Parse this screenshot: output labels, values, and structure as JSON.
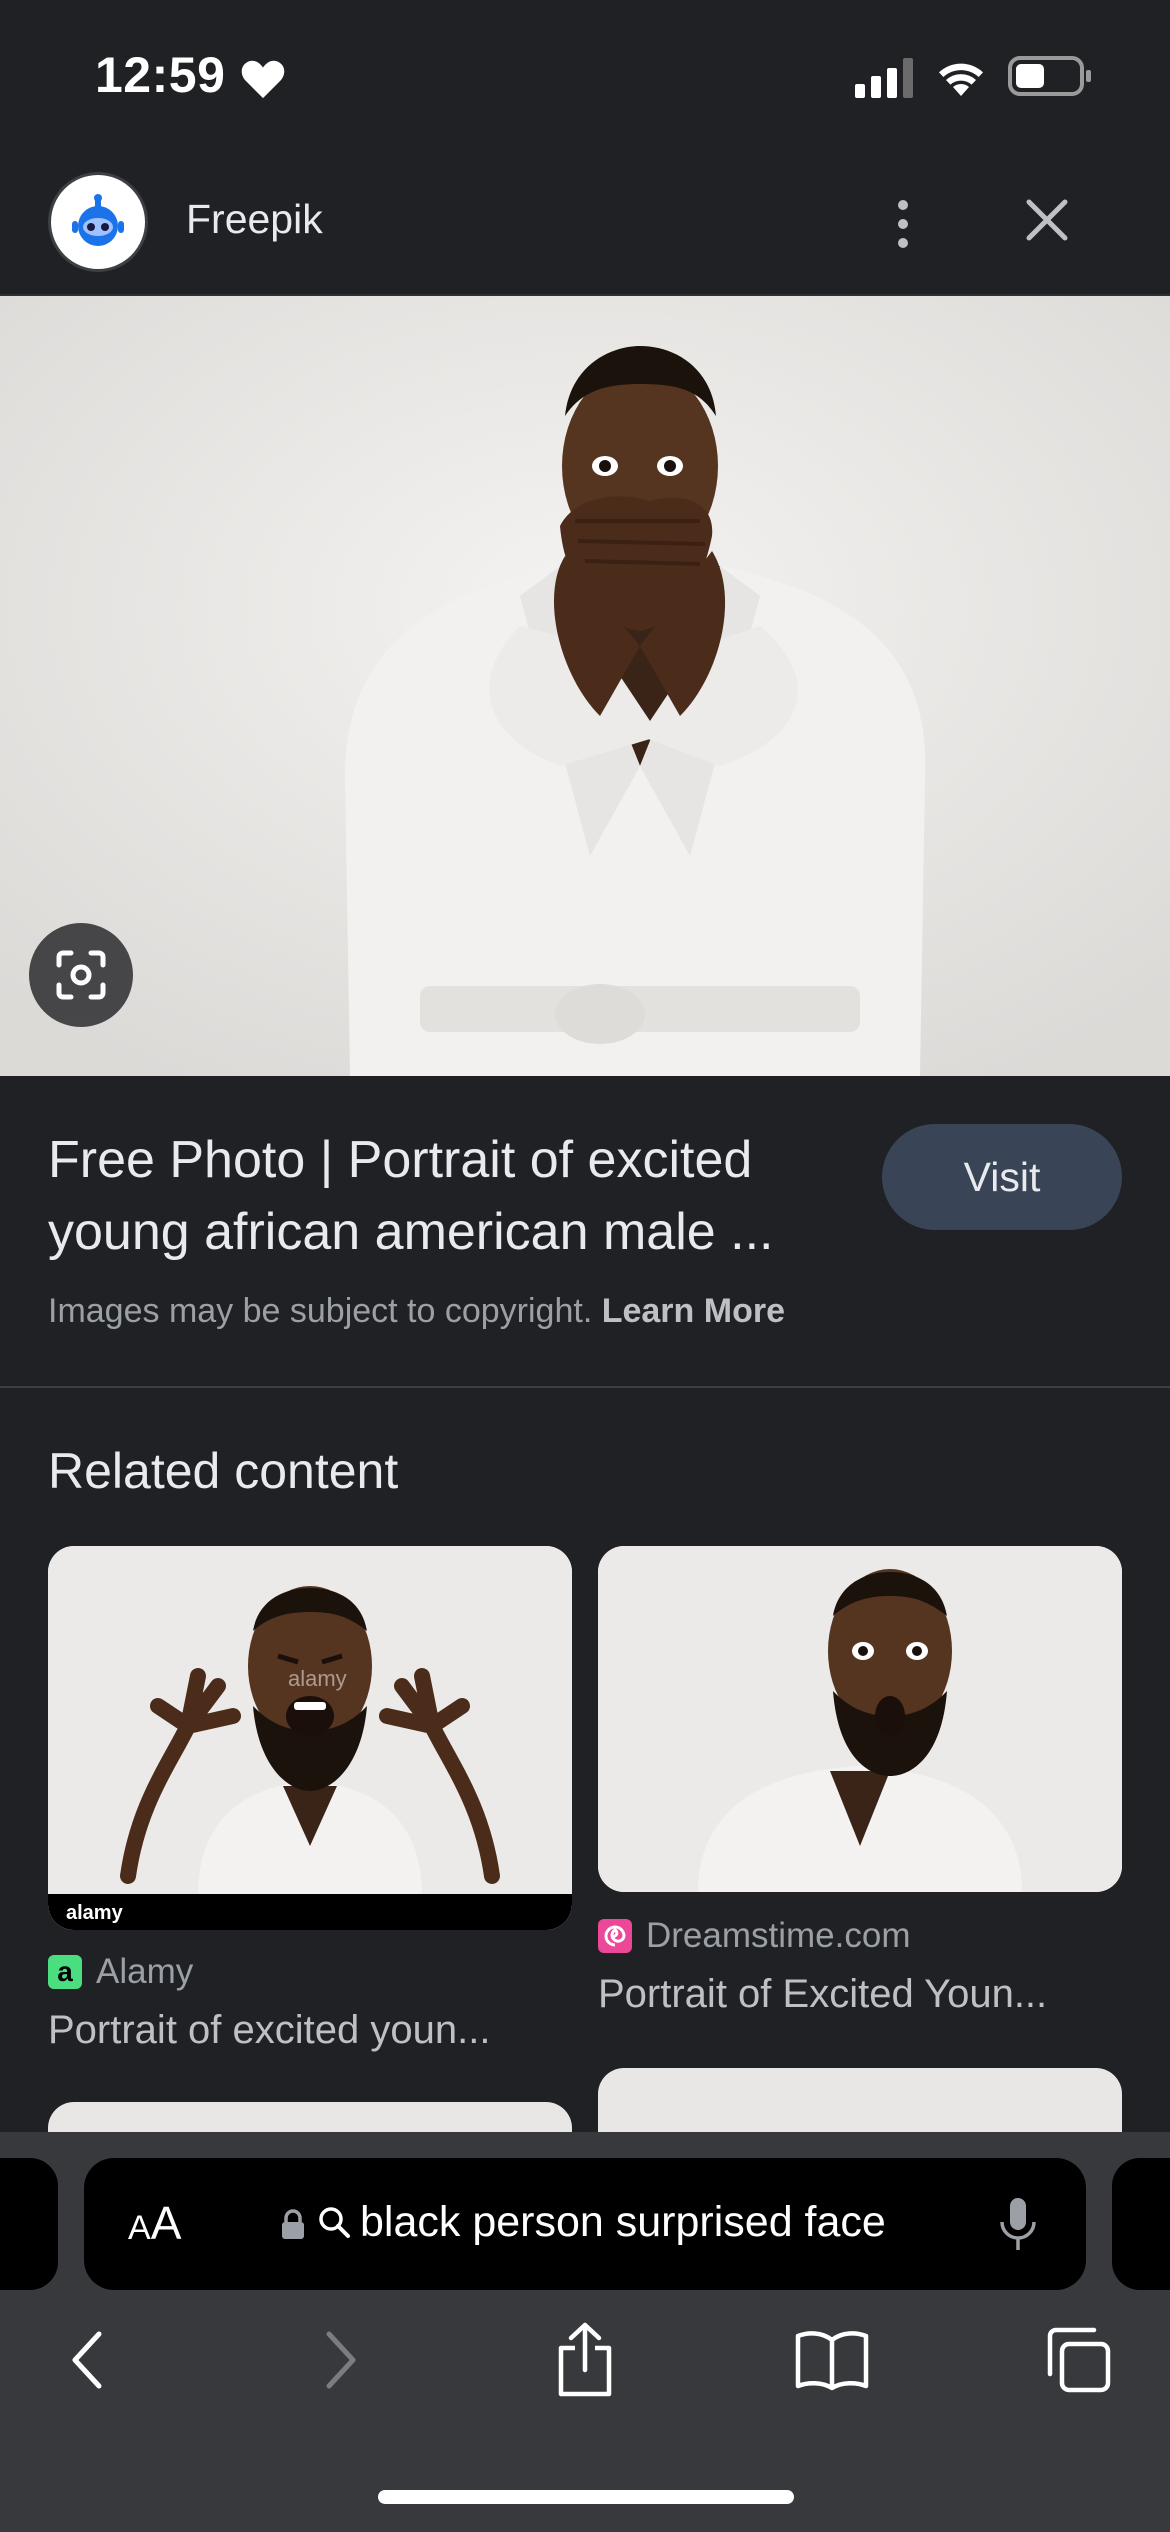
{
  "status_bar": {
    "time": "12:59"
  },
  "header": {
    "site_name": "Freepik"
  },
  "result": {
    "title": "Free Photo | Portrait of excited young african american male ...",
    "visit_label": "Visit",
    "copyright_text": "Images may be subject to copyright.",
    "learn_more_label": "Learn More"
  },
  "related": {
    "heading": "Related content",
    "items": [
      {
        "source": "Alamy",
        "title": "Portrait of excited youn...",
        "favicon_color": "#4ade80",
        "favicon_letter": "a",
        "watermark": "alamy"
      },
      {
        "source": "Dreamstime.com",
        "title": "Portrait of Excited Youn...",
        "favicon_color": "#ec4899"
      }
    ]
  },
  "toolbar": {
    "text_size_label_small": "A",
    "text_size_label_large": "A",
    "address_text": "black person surprised face"
  },
  "colors": {
    "background": "#202124",
    "visit_button": "#394457",
    "toolbar": "#38393c"
  }
}
